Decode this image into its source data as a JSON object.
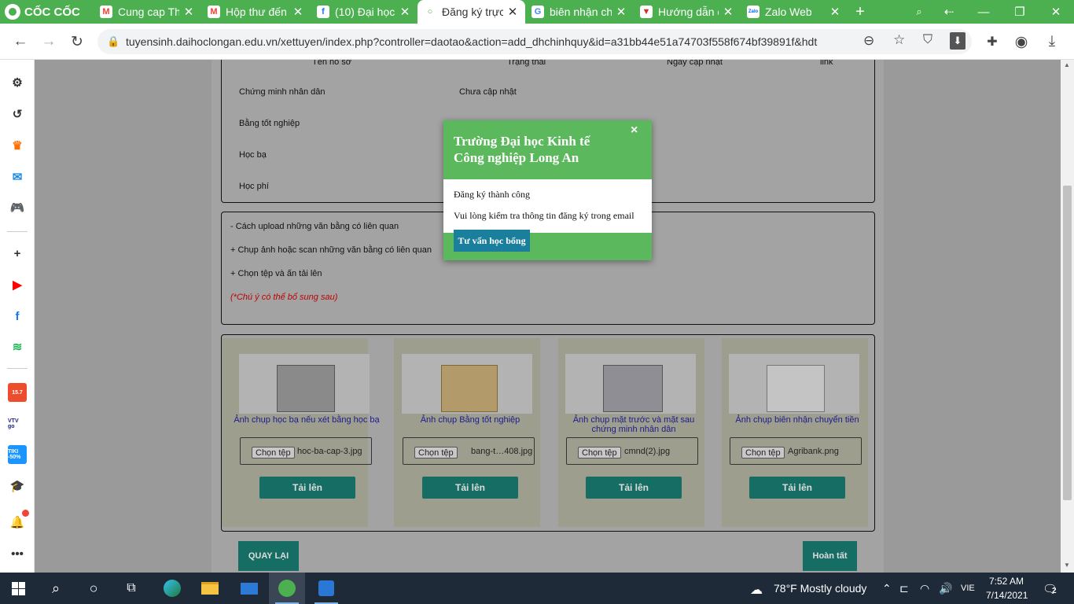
{
  "browser": {
    "brand": "CỐC CỐC",
    "tabs": [
      {
        "label": "Cung cap Th",
        "icon": "M",
        "icon_color": "#ea4335"
      },
      {
        "label": "Hộp thư đến",
        "icon": "M",
        "icon_color": "#ea4335"
      },
      {
        "label": "(10) Đại học",
        "icon": "f",
        "icon_color": "#1877f2"
      },
      {
        "label": "Đăng ký trực",
        "icon": "○",
        "icon_color": "#4caf50"
      },
      {
        "label": "biên nhận ch",
        "icon": "G",
        "icon_color": "#4285f4"
      },
      {
        "label": "Hướng dẫn c",
        "icon": "▼",
        "icon_color": "#d32f2f"
      },
      {
        "label": "Zalo Web",
        "icon": "Zalo",
        "icon_color": "#0068ff"
      }
    ],
    "active_tab_index": 3,
    "url": "tuyensinh.daihoclongan.edu.vn/xettuyen/index.php?controller=daotao&action=add_dhchinhquy&id=a31bb44e51a74703f558f674bf39891f&hdt=dh..."
  },
  "sidebar": {
    "items": [
      {
        "name": "settings",
        "icon": "⚙"
      },
      {
        "name": "history",
        "icon": "↺"
      },
      {
        "name": "crown",
        "icon": "♛"
      },
      {
        "name": "messenger",
        "icon": "✉"
      },
      {
        "name": "games",
        "icon": "🎮"
      },
      {
        "name": "add",
        "icon": "+"
      },
      {
        "name": "youtube",
        "icon": "▶"
      },
      {
        "name": "facebook",
        "icon": "f"
      },
      {
        "name": "spotify",
        "icon": "≋"
      },
      {
        "name": "shopee",
        "icon": "15.7"
      },
      {
        "name": "vtv",
        "icon": "VTV go"
      },
      {
        "name": "tiki",
        "icon": "TIKI -50%"
      },
      {
        "name": "education",
        "icon": "🎓"
      },
      {
        "name": "notifications",
        "icon": "🔔"
      },
      {
        "name": "more",
        "icon": "•••"
      }
    ]
  },
  "documents": {
    "headers": [
      "Tên hồ sơ",
      "Trạng thái",
      "Ngày cập nhật",
      "link"
    ],
    "rows": [
      {
        "name": "Chứng minh nhân dân",
        "status": "Chưa cập nhật"
      },
      {
        "name": "Bằng tốt nghiệp",
        "status": ""
      },
      {
        "name": "Học bạ",
        "status": ""
      },
      {
        "name": "Học phí",
        "status": ""
      }
    ]
  },
  "instructions": {
    "line1": "- Cách upload những văn bằng có liên quan",
    "line2": "+ Chụp ảnh hoặc scan những văn bằng có liên quan",
    "line3": "+ Chọn tệp và ấn tải lên",
    "note": "(*Chú ý có thể bổ sung sau)"
  },
  "uploads": {
    "choose_label": "Chọn tệp",
    "upload_label": "Tải lên",
    "cards": [
      {
        "caption": "Ảnh chụp học bạ nếu xét bằng học bạ",
        "file": "hoc-ba-cap-3.jpg"
      },
      {
        "caption": "Ảnh chụp Bằng tốt nghiệp",
        "file": "bang-t…408.jpg"
      },
      {
        "caption": "Ảnh chụp mặt trước và mặt sau chứng minh nhân dân",
        "file": "cmnd(2).jpg"
      },
      {
        "caption": "Ảnh chụp biên nhận chuyển tiền",
        "file": "Agribank.png"
      }
    ]
  },
  "nav": {
    "back": "QUAY LẠI",
    "finish": "Hoàn tất"
  },
  "modal": {
    "title": "Trường Đại học Kinh tế Công nghiệp Long An",
    "message1": "Đăng ký thành công",
    "message2": "Vui lòng kiểm tra thông tin đăng ký trong email",
    "button": "Tư vấn học bổng",
    "close": "×"
  },
  "taskbar": {
    "weather": "78°F  Mostly cloudy",
    "lang": "VIE",
    "time": "7:52 AM",
    "date": "7/14/2021",
    "notification_count": "2"
  },
  "colors": {
    "accent": "#4caf50",
    "teal": "#166d64",
    "modal_green": "#5cb85c",
    "modal_button": "#1a7f9c",
    "link_blue": "#1c1b8f",
    "note_red": "#c00000"
  }
}
